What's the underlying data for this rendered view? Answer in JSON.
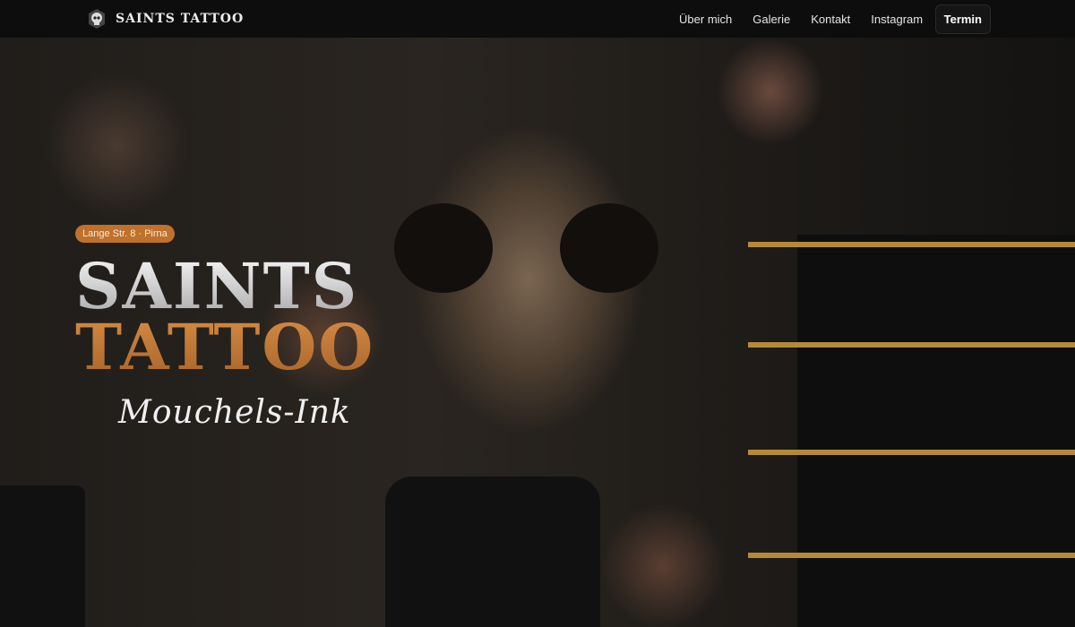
{
  "nav": {
    "brand": "SAINTS TATTOO",
    "links": [
      "Über mich",
      "Galerie",
      "Kontakt",
      "Instagram"
    ],
    "cta": "Termin"
  },
  "hero": {
    "address_badge": "Lange Str. 8 · Pirna",
    "title_line1": "SAINTS",
    "title_line2": "TATTOO",
    "subtitle": "Mouchels-Ink"
  },
  "colors": {
    "accent": "#c0712c",
    "nav_bg": "#0d0d0d"
  }
}
